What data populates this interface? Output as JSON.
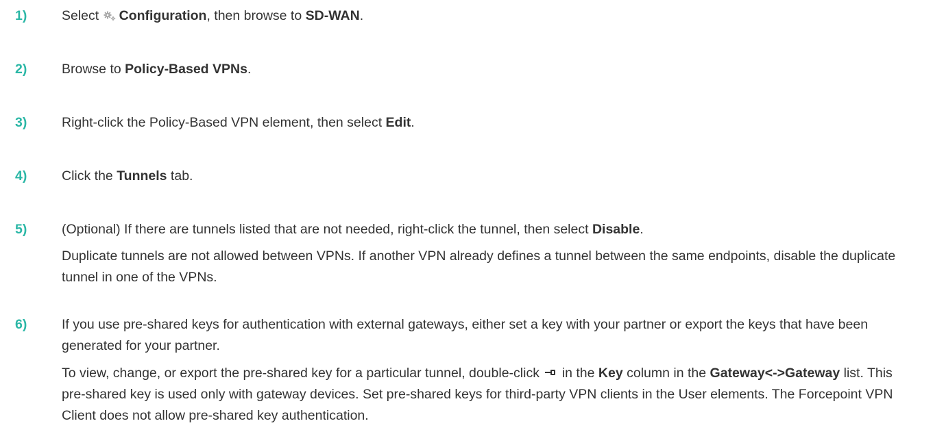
{
  "steps": [
    {
      "number": "1)",
      "parts": [
        {
          "t": "Select "
        },
        {
          "icon": "gear-icon"
        },
        {
          "t": "Configuration",
          "b": true
        },
        {
          "t": ", then browse to "
        },
        {
          "t": "SD-WAN",
          "b": true
        },
        {
          "t": "."
        }
      ]
    },
    {
      "number": "2)",
      "parts": [
        {
          "t": "Browse to "
        },
        {
          "t": "Policy-Based VPNs",
          "b": true
        },
        {
          "t": "."
        }
      ]
    },
    {
      "number": "3)",
      "parts": [
        {
          "t": "Right-click the Policy-Based VPN element, then select "
        },
        {
          "t": "Edit",
          "b": true
        },
        {
          "t": "."
        }
      ]
    },
    {
      "number": "4)",
      "parts": [
        {
          "t": "Click the "
        },
        {
          "t": "Tunnels",
          "b": true
        },
        {
          "t": " tab."
        }
      ]
    },
    {
      "number": "5)",
      "parts": [
        {
          "t": "(Optional) If there are tunnels listed that are not needed, right-click the tunnel, then select "
        },
        {
          "t": "Disable",
          "b": true
        },
        {
          "t": "."
        }
      ],
      "note_parts": [
        {
          "t": "Duplicate tunnels are not allowed between VPNs. If another VPN already defines a tunnel between the same endpoints, disable the duplicate tunnel in one of the VPNs."
        }
      ]
    },
    {
      "number": "6)",
      "parts": [
        {
          "t": "If you use pre-shared keys for authentication with external gateways, either set a key with your partner or export the keys that have been generated for your partner."
        }
      ],
      "note_parts": [
        {
          "t": "To view, change, or export the pre-shared key for a particular tunnel, double-click "
        },
        {
          "icon": "key-icon"
        },
        {
          "t": " in the "
        },
        {
          "t": "Key",
          "b": true
        },
        {
          "t": " column in the "
        },
        {
          "t": "Gateway<->Gateway",
          "b": true
        },
        {
          "t": " list. This pre-shared key is used only with gateway devices. Set pre-shared keys for third-party VPN clients in the User elements. The Forcepoint VPN Client does not allow pre-shared key authentication."
        }
      ]
    }
  ],
  "colors": {
    "step_number": "#2bb7a6",
    "text": "#333333",
    "icon": "#a9a9a9"
  }
}
